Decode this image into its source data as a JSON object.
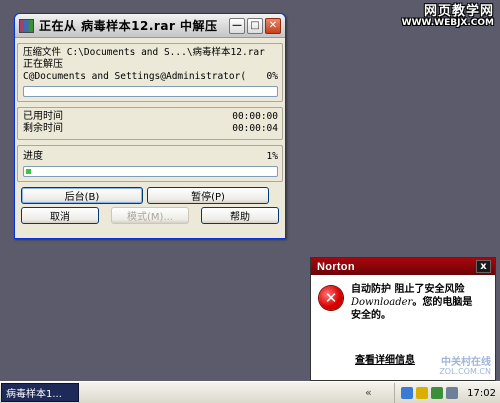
{
  "watermark": {
    "site_name": "网页教学网",
    "site_url": "WWW.WEBJX.COM"
  },
  "rar_window": {
    "title": "正在从 病毒样本12.rar 中解压",
    "archive_label": "压缩文件 C:\\Documents and S...\\病毒样本12.rar",
    "status_label": "正在解压",
    "current_file": "C@Documents and Settings@Administrator(",
    "file_percent": "0%",
    "file_progress": 0,
    "elapsed_label": "已用时间",
    "elapsed_value": "00:00:00",
    "remaining_label": "剩余时间",
    "remaining_value": "00:00:04",
    "total_label": "进度",
    "total_percent": "1%",
    "total_progress": 0.01,
    "buttons": {
      "background": "后台(B)",
      "pause": "暂停(P)",
      "cancel": "取消",
      "mode": "模式(M)...",
      "help": "帮助"
    }
  },
  "norton": {
    "brand": "Norton",
    "close_glyph": "x",
    "error_glyph": "✕",
    "message_line1": "自动防护 阻止了安全风险",
    "threat_name": "Downloader",
    "message_line2": "。您的电脑是",
    "message_line3": "安全的。",
    "details_link": "查看详细信息",
    "watermark_line1": "中关村在线",
    "watermark_line2": "ZOL.COM.CN"
  },
  "taskbar": {
    "task_label": "病毒样本1...",
    "clock": "17:02",
    "expand_glyph": "«"
  },
  "colors": {
    "desktop": "#5b5b6b",
    "norton_header": "#a8070c",
    "progress_fill": "#3ec43e",
    "task_active": "#1e2a58"
  }
}
